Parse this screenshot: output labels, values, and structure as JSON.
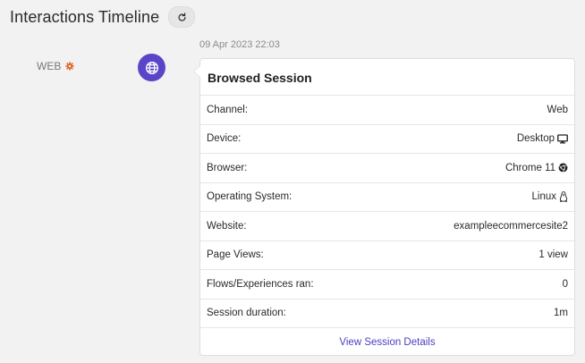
{
  "header": {
    "title": "Interactions Timeline"
  },
  "event": {
    "timestamp": "09 Apr 2023 22:03",
    "channel_label": "WEB",
    "card_title": "Browsed Session",
    "rows": [
      {
        "label": "Channel:",
        "value": "Web",
        "icon": ""
      },
      {
        "label": "Device:",
        "value": "Desktop",
        "icon": "desktop-icon"
      },
      {
        "label": "Browser:",
        "value": "Chrome 11",
        "icon": "chrome-icon"
      },
      {
        "label": "Operating System:",
        "value": "Linux",
        "icon": "linux-icon"
      },
      {
        "label": "Website:",
        "value": "exampleecommercesite2",
        "icon": ""
      },
      {
        "label": "Page Views:",
        "value": "1 view",
        "icon": ""
      },
      {
        "label": "Flows/Experiences ran:",
        "value": "0",
        "icon": ""
      },
      {
        "label": "Session duration:",
        "value": "1m",
        "icon": ""
      }
    ],
    "footer_link": "View Session Details"
  },
  "colors": {
    "accent": "#5a45c8",
    "link": "#4a3fc4",
    "gear": "#e0621e"
  }
}
